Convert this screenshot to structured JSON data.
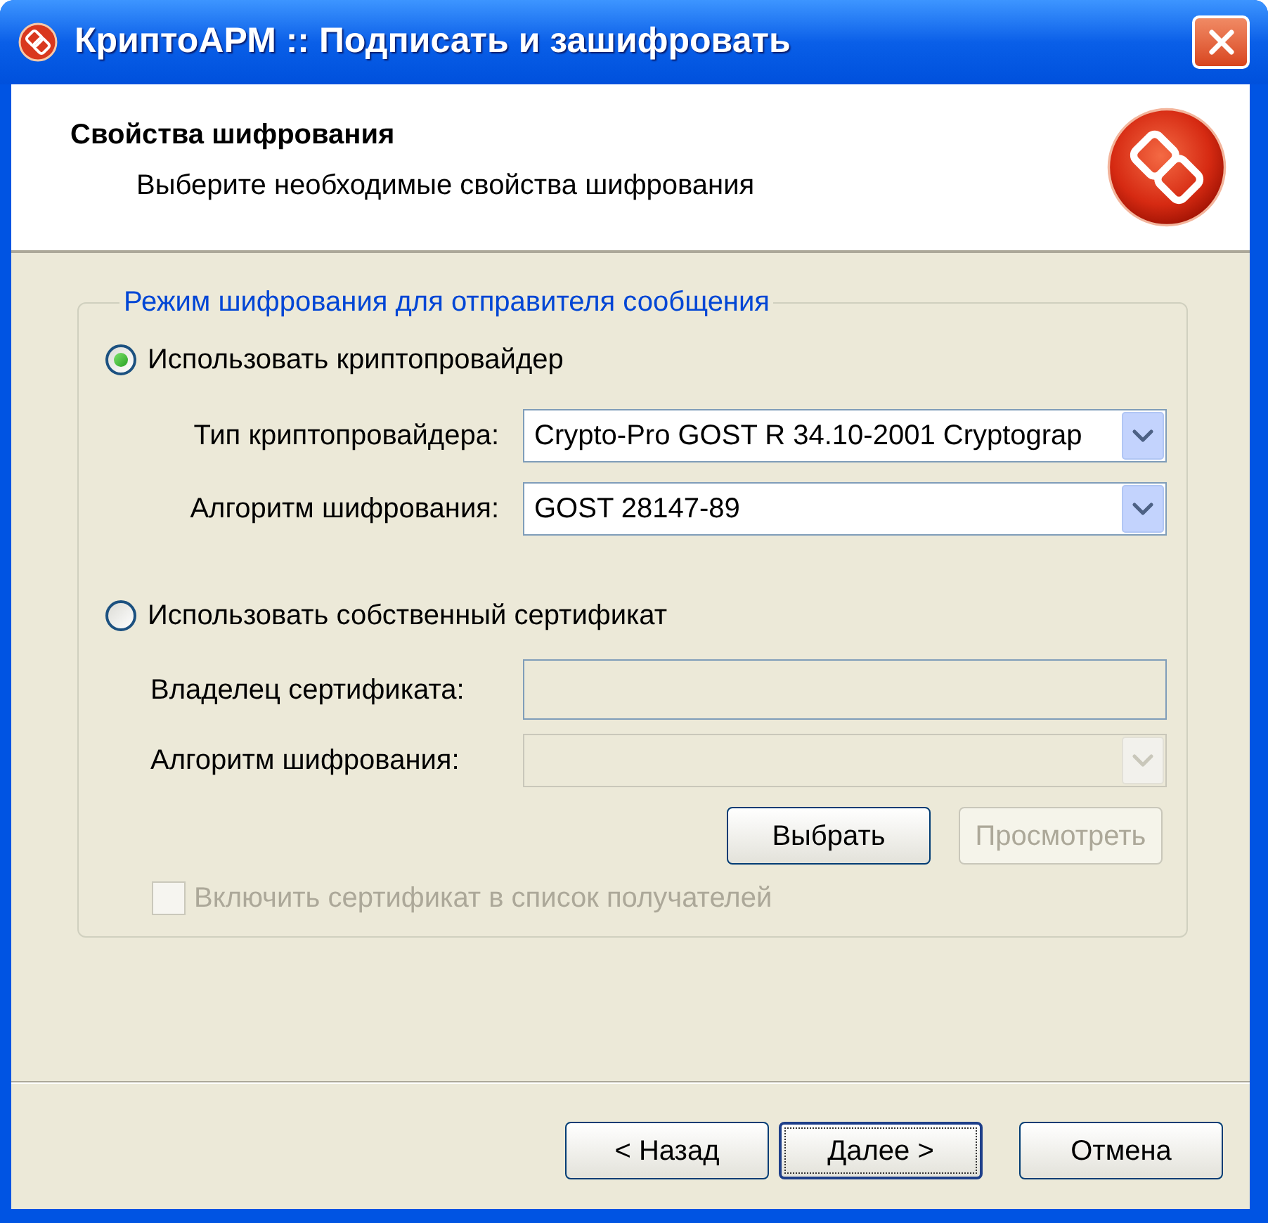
{
  "window": {
    "title": "КриптоАРМ :: Подписать и зашифровать"
  },
  "header": {
    "title": "Свойства шифрования",
    "subtitle": "Выберите необходимые свойства шифрования"
  },
  "group": {
    "legend": "Режим шифрования для отправителя сообщения",
    "options": [
      {
        "label": "Использовать криптопровайдер",
        "selected": true,
        "fields": [
          {
            "kind": "dropdown",
            "label": "Тип криптопровайдера:",
            "value": "Crypto-Pro GOST R 34.10-2001 Cryptograp",
            "disabled": false
          },
          {
            "kind": "dropdown",
            "label": "Алгоритм шифрования:",
            "value": "GOST 28147-89",
            "disabled": false
          }
        ]
      },
      {
        "label": "Использовать собственный сертификат",
        "selected": false,
        "fields": [
          {
            "kind": "text",
            "label": "Владелец сертификата:",
            "disabled": false
          },
          {
            "kind": "dropdown",
            "label": "Алгоритм шифрования:",
            "disabled": true
          }
        ]
      }
    ],
    "actions": [
      {
        "label": "Выбрать",
        "disabled": false
      },
      {
        "label": "Просмотреть",
        "disabled": true
      }
    ],
    "checkbox": {
      "label": "Включить сертификат в список получателей",
      "checked": false,
      "disabled": true
    }
  },
  "footer": {
    "buttons": [
      {
        "label": "< Назад",
        "focused": false
      },
      {
        "label": "Далее >",
        "focused": true
      },
      {
        "label": "Отмена",
        "focused": false
      }
    ]
  }
}
